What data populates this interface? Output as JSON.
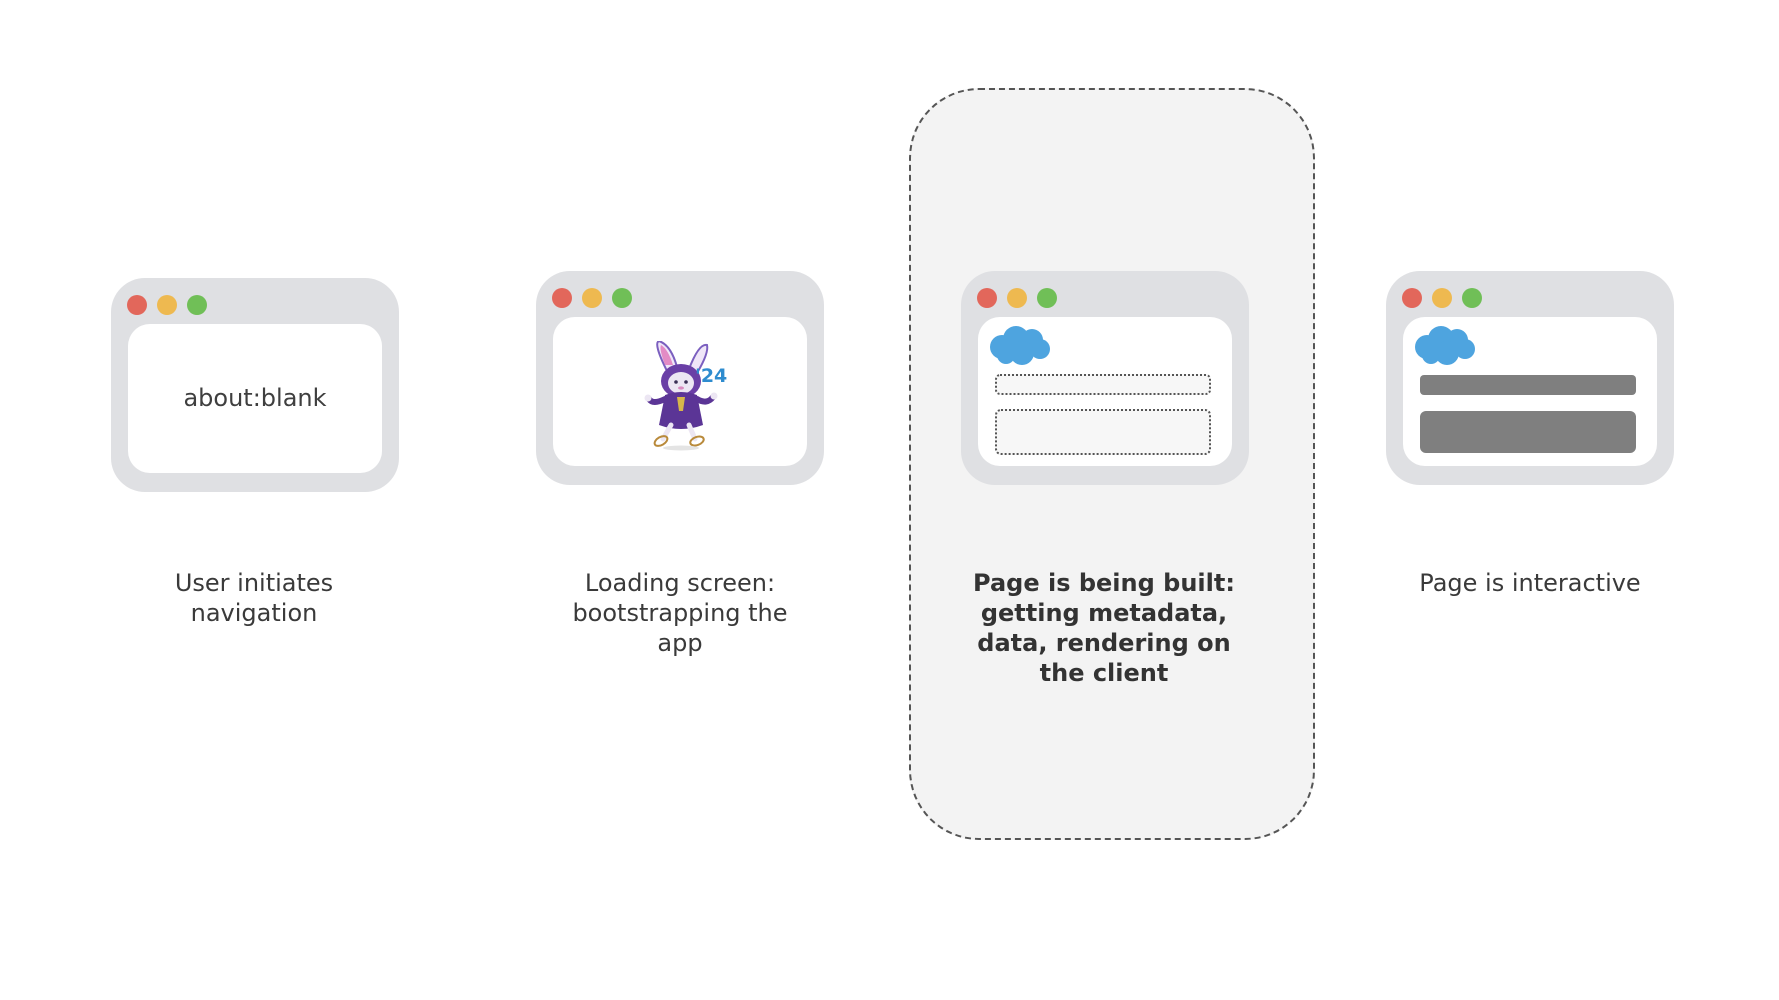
{
  "stages": [
    {
      "caption_lines": [
        "User initiates",
        "navigation"
      ],
      "window_text": "about:blank"
    },
    {
      "caption_lines": [
        "Loading screen:",
        "bootstrapping the",
        "app"
      ],
      "badge_text": "'24"
    },
    {
      "caption_lines": [
        "Page is being built:",
        "getting metadata,",
        "data, rendering on",
        "the client"
      ],
      "highlighted": true
    },
    {
      "caption_lines": [
        "Page is interactive"
      ]
    }
  ],
  "colors": {
    "window_frame": "#dfe0e3",
    "traffic_red": "#e2675b",
    "traffic_yellow": "#eeb950",
    "traffic_green": "#70bf57",
    "cloud_blue": "#4ea4df",
    "skeleton_fill": "#7f7f7f",
    "highlight_panel": "#f3f3f3"
  },
  "icons": [
    "salesforce-cloud-icon",
    "mascot-icon"
  ]
}
